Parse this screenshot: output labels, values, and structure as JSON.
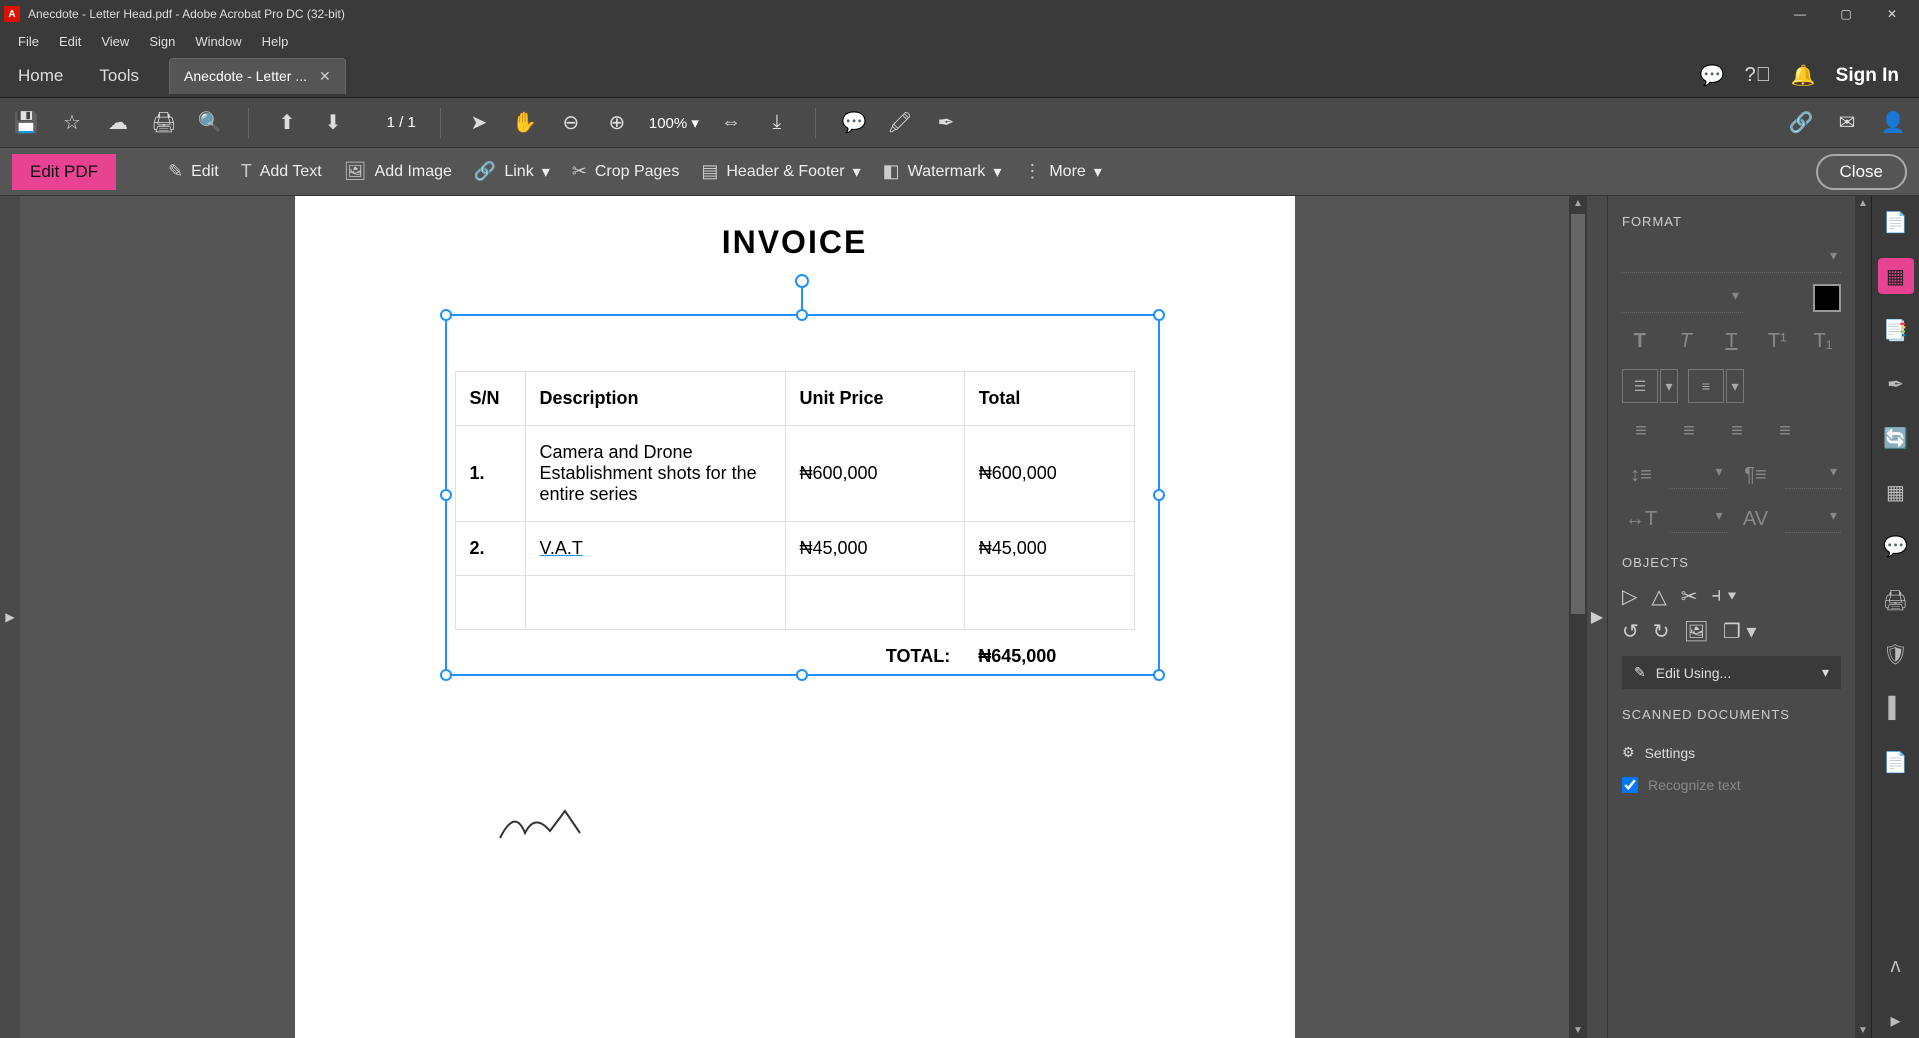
{
  "titlebar": {
    "app_icon": "A",
    "title": "Anecdote - Letter Head.pdf - Adobe Acrobat Pro DC (32-bit)"
  },
  "menubar": [
    "File",
    "Edit",
    "View",
    "Sign",
    "Window",
    "Help"
  ],
  "tabrow": {
    "home": "Home",
    "tools": "Tools",
    "doc": "Anecdote - Letter ...",
    "signin": "Sign In"
  },
  "toolbar": {
    "page_current": "1",
    "page_sep": "/",
    "page_total": "1",
    "zoom": "100%"
  },
  "edittoolbar": {
    "label": "Edit PDF",
    "edit": "Edit",
    "add_text": "Add Text",
    "add_image": "Add Image",
    "link": "Link",
    "crop": "Crop Pages",
    "header_footer": "Header & Footer",
    "watermark": "Watermark",
    "more": "More",
    "close": "Close"
  },
  "document": {
    "heading": "INVOICE",
    "table": {
      "headers": {
        "sn": "S/N",
        "desc": "Description",
        "unit": "Unit Price",
        "total": "Total"
      },
      "rows": [
        {
          "sn": "1.",
          "desc": "Camera and Drone Establishment shots for the entire series",
          "unit": "₦600,000",
          "total": "₦600,000"
        },
        {
          "sn": "2.",
          "desc": "V.A.T",
          "unit": "₦45,000",
          "total": "₦45,000"
        }
      ],
      "total_label": "TOTAL:",
      "total_value": "₦645,000"
    }
  },
  "rightpanel": {
    "format_title": "FORMAT",
    "objects_title": "OBJECTS",
    "edit_using": "Edit Using...",
    "scanned_title": "SCANNED DOCUMENTS",
    "settings": "Settings",
    "recognize": "Recognize text"
  }
}
